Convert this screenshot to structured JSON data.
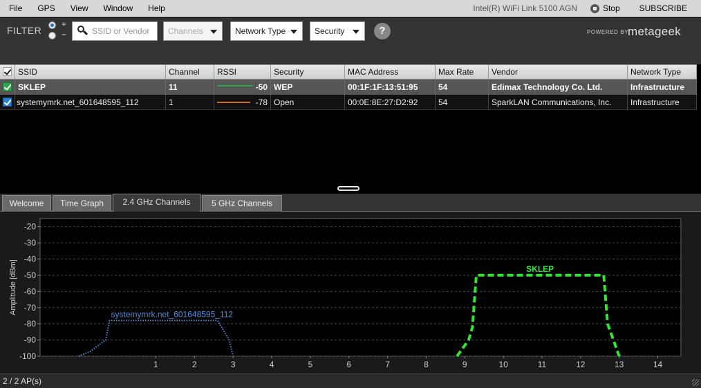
{
  "menu": {
    "items": [
      "File",
      "GPS",
      "View",
      "Window",
      "Help"
    ],
    "adapter": "Intel(R) WiFi Link 5100 AGN",
    "stop_label": "Stop",
    "subscribe_label": "SUBSCRIBE"
  },
  "filter": {
    "label": "FILTER",
    "plus": "+",
    "minus": "−",
    "search_placeholder": "SSID or Vendor",
    "channels_label": "Channels",
    "network_type_label": "Network Type",
    "security_label": "Security",
    "help_label": "?",
    "powered_by": "POWERED BY",
    "brand": "metageek"
  },
  "table": {
    "columns": [
      "SSID",
      "Channel",
      "RSSI",
      "Security",
      "MAC Address",
      "Max Rate",
      "Vendor",
      "Network Type"
    ],
    "rows": [
      {
        "ssid": "SKLEP",
        "channel": "11",
        "rssi": "-50",
        "security": "WEP",
        "mac": "00:1F:1F:13:51:95",
        "max_rate": "54",
        "vendor": "Edimax Technology Co. Ltd.",
        "network_type": "Infrastructure",
        "color": "#2ba84a"
      },
      {
        "ssid": "systemymrk.net_601648595_112",
        "channel": "1",
        "rssi": "-78",
        "security": "Open",
        "mac": "00:0E:8E:27:D2:92",
        "max_rate": "54",
        "vendor": "SparkLAN Communications, Inc.",
        "network_type": "Infrastructure",
        "color": "#2b7fd0"
      }
    ]
  },
  "tabs": [
    "Welcome",
    "Time Graph",
    "2.4 GHz Channels",
    "5 GHz Channels"
  ],
  "active_tab": "2.4 GHz Channels",
  "chart_data": {
    "type": "area",
    "xlabel": "",
    "ylabel": "Amplitude [dBm]",
    "ylim": [
      -100,
      -15
    ],
    "yticks": [
      -20,
      -30,
      -40,
      -50,
      -60,
      -70,
      -80,
      -90,
      -100
    ],
    "xlim": [
      -2,
      14.6
    ],
    "xticks": [
      1,
      2,
      3,
      4,
      5,
      6,
      7,
      8,
      9,
      10,
      11,
      12,
      13,
      14
    ],
    "grid": true,
    "series": [
      {
        "name": "systemymrk.net_601648595_112",
        "color": "#4a90d9",
        "style": "dotted",
        "points": [
          [
            -1.0,
            -100
          ],
          [
            -0.7,
            -97
          ],
          [
            -0.3,
            -90
          ],
          [
            -0.2,
            -78
          ],
          [
            2.6,
            -78
          ],
          [
            2.7,
            -82
          ],
          [
            2.9,
            -90
          ],
          [
            3.0,
            -100
          ]
        ]
      },
      {
        "name": "SKLEP",
        "color": "#33e533",
        "style": "dashed",
        "points": [
          [
            8.8,
            -100
          ],
          [
            9.1,
            -90
          ],
          [
            9.2,
            -82
          ],
          [
            9.3,
            -50
          ],
          [
            12.6,
            -50
          ],
          [
            12.7,
            -80
          ],
          [
            13.0,
            -100
          ]
        ]
      }
    ]
  },
  "status": "2 / 2 AP(s)"
}
